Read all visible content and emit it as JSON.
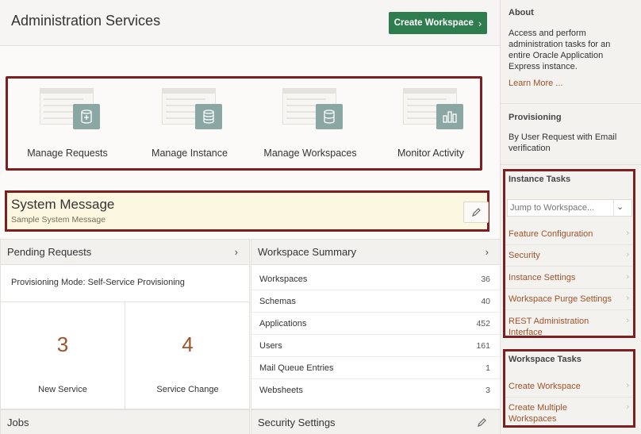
{
  "header": {
    "title": "Administration Services",
    "create_button": "Create Workspace",
    "create_chevron": "›"
  },
  "cards": [
    {
      "label": "Manage Requests",
      "icon": "database-plus-icon",
      "glyph": "⊕"
    },
    {
      "label": "Manage Instance",
      "icon": "database-icon",
      "glyph": "☰"
    },
    {
      "label": "Manage Workspaces",
      "icon": "database-icon",
      "glyph": "☰"
    },
    {
      "label": "Monitor Activity",
      "icon": "bar-chart-icon",
      "glyph": "▥"
    }
  ],
  "system_message": {
    "title": "System Message",
    "subtitle": "Sample System Message"
  },
  "pending_requests": {
    "title": "Pending Requests",
    "chevron": "›",
    "provisioning_mode": "Provisioning Mode: Self-Service Provisioning",
    "stats": [
      {
        "value": "3",
        "label": "New Service"
      },
      {
        "value": "4",
        "label": "Service Change"
      }
    ]
  },
  "workspace_summary": {
    "title": "Workspace Summary",
    "chevron": "›",
    "rows": [
      {
        "label": "Workspaces",
        "value": "36"
      },
      {
        "label": "Schemas",
        "value": "40"
      },
      {
        "label": "Applications",
        "value": "452"
      },
      {
        "label": "Users",
        "value": "161"
      },
      {
        "label": "Mail Queue Entries",
        "value": "1"
      },
      {
        "label": "Websheets",
        "value": "3"
      }
    ]
  },
  "jobs": {
    "title": "Jobs"
  },
  "security_settings": {
    "title": "Security Settings"
  },
  "sidebar": {
    "about": {
      "title": "About",
      "text": "Access and perform administration tasks for an entire Oracle Application Express instance.",
      "link": "Learn More ..."
    },
    "provisioning": {
      "title": "Provisioning",
      "text": "By User Request with Email verification"
    },
    "instance_tasks": {
      "title": "Instance Tasks",
      "jump_placeholder": "Jump to Workspace...",
      "dropdown": "⌄",
      "items": [
        "Feature Configuration",
        "Security",
        "Instance Settings",
        "Workspace Purge Settings",
        "REST Administration Interface"
      ]
    },
    "workspace_tasks": {
      "title": "Workspace Tasks",
      "items": [
        "Create Workspace",
        "Create Multiple Workspaces"
      ]
    },
    "item_chevron": "›"
  },
  "colors": {
    "primary_button": "#2f7d4e",
    "link": "#a0532a",
    "highlight_border": "#7d1f1f",
    "icon_tile": "#8aa7a3",
    "system_message_bg": "#fcf7e1"
  }
}
